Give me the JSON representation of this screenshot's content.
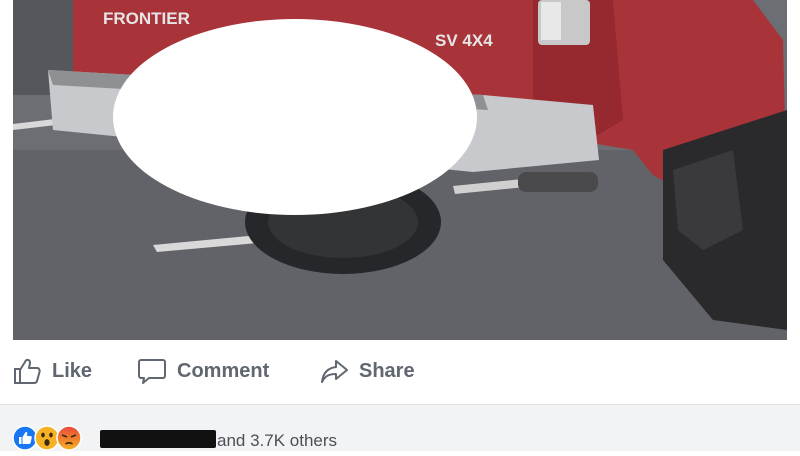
{
  "photo": {
    "tailgate_badge": "FRONTIER",
    "trim_badge": "SV 4X4",
    "redaction_color": "#ffffff",
    "truck_color": "#b0383d"
  },
  "actions": {
    "like_label": "Like",
    "comment_label": "Comment",
    "share_label": "Share",
    "icons": [
      "thumbs-up-icon",
      "comment-bubble-icon",
      "share-arrow-icon"
    ]
  },
  "reactions": {
    "icons": [
      "like-reaction-icon",
      "wow-reaction-icon",
      "angry-reaction-icon"
    ],
    "others_text": "and 3.7K others"
  },
  "colors": {
    "action_text": "#606770",
    "like_blue": "#1877f2",
    "reaction_bar_bg": "#f2f3f5"
  }
}
